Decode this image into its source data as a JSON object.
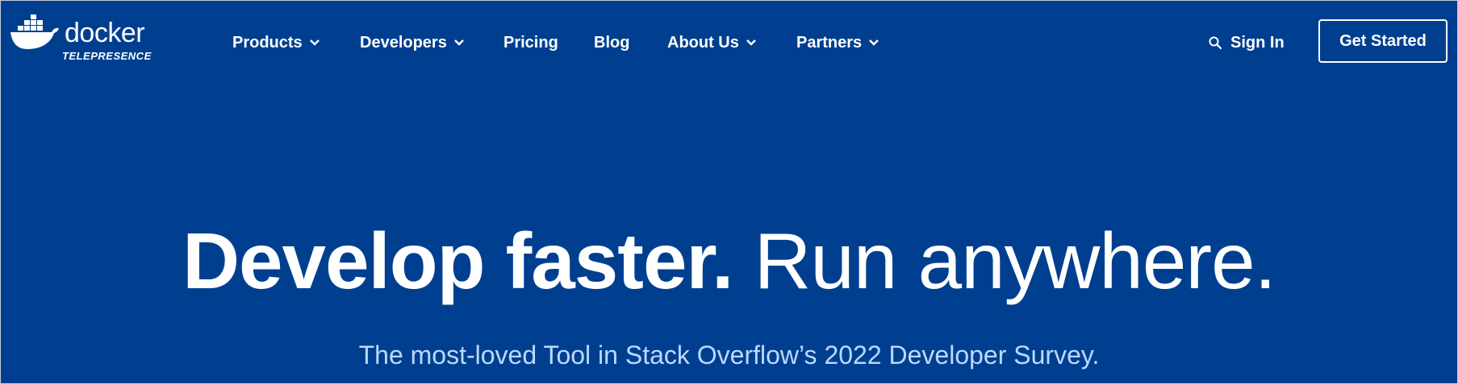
{
  "brand": {
    "wordmark": "docker",
    "subtitle": "TELEPRESENCE",
    "logo_icon": "docker-whale-icon"
  },
  "nav": {
    "items": [
      {
        "label": "Products",
        "has_dropdown": true
      },
      {
        "label": "Developers",
        "has_dropdown": true
      },
      {
        "label": "Pricing",
        "has_dropdown": false
      },
      {
        "label": "Blog",
        "has_dropdown": false
      },
      {
        "label": "About Us",
        "has_dropdown": true
      },
      {
        "label": "Partners",
        "has_dropdown": true
      }
    ],
    "dropdown_icon": "chevron-down-icon"
  },
  "header_actions": {
    "search_icon": "search-icon",
    "sign_in_label": "Sign In",
    "get_started_label": "Get Started"
  },
  "hero": {
    "title_bold": "Develop faster.",
    "title_light": "Run anywhere.",
    "subtitle": "The most-loved Tool in Stack Overflow’s 2022 Developer Survey."
  },
  "colors": {
    "background": "#003f8f",
    "text": "#ffffff",
    "subtitle": "#bcd8ff"
  }
}
